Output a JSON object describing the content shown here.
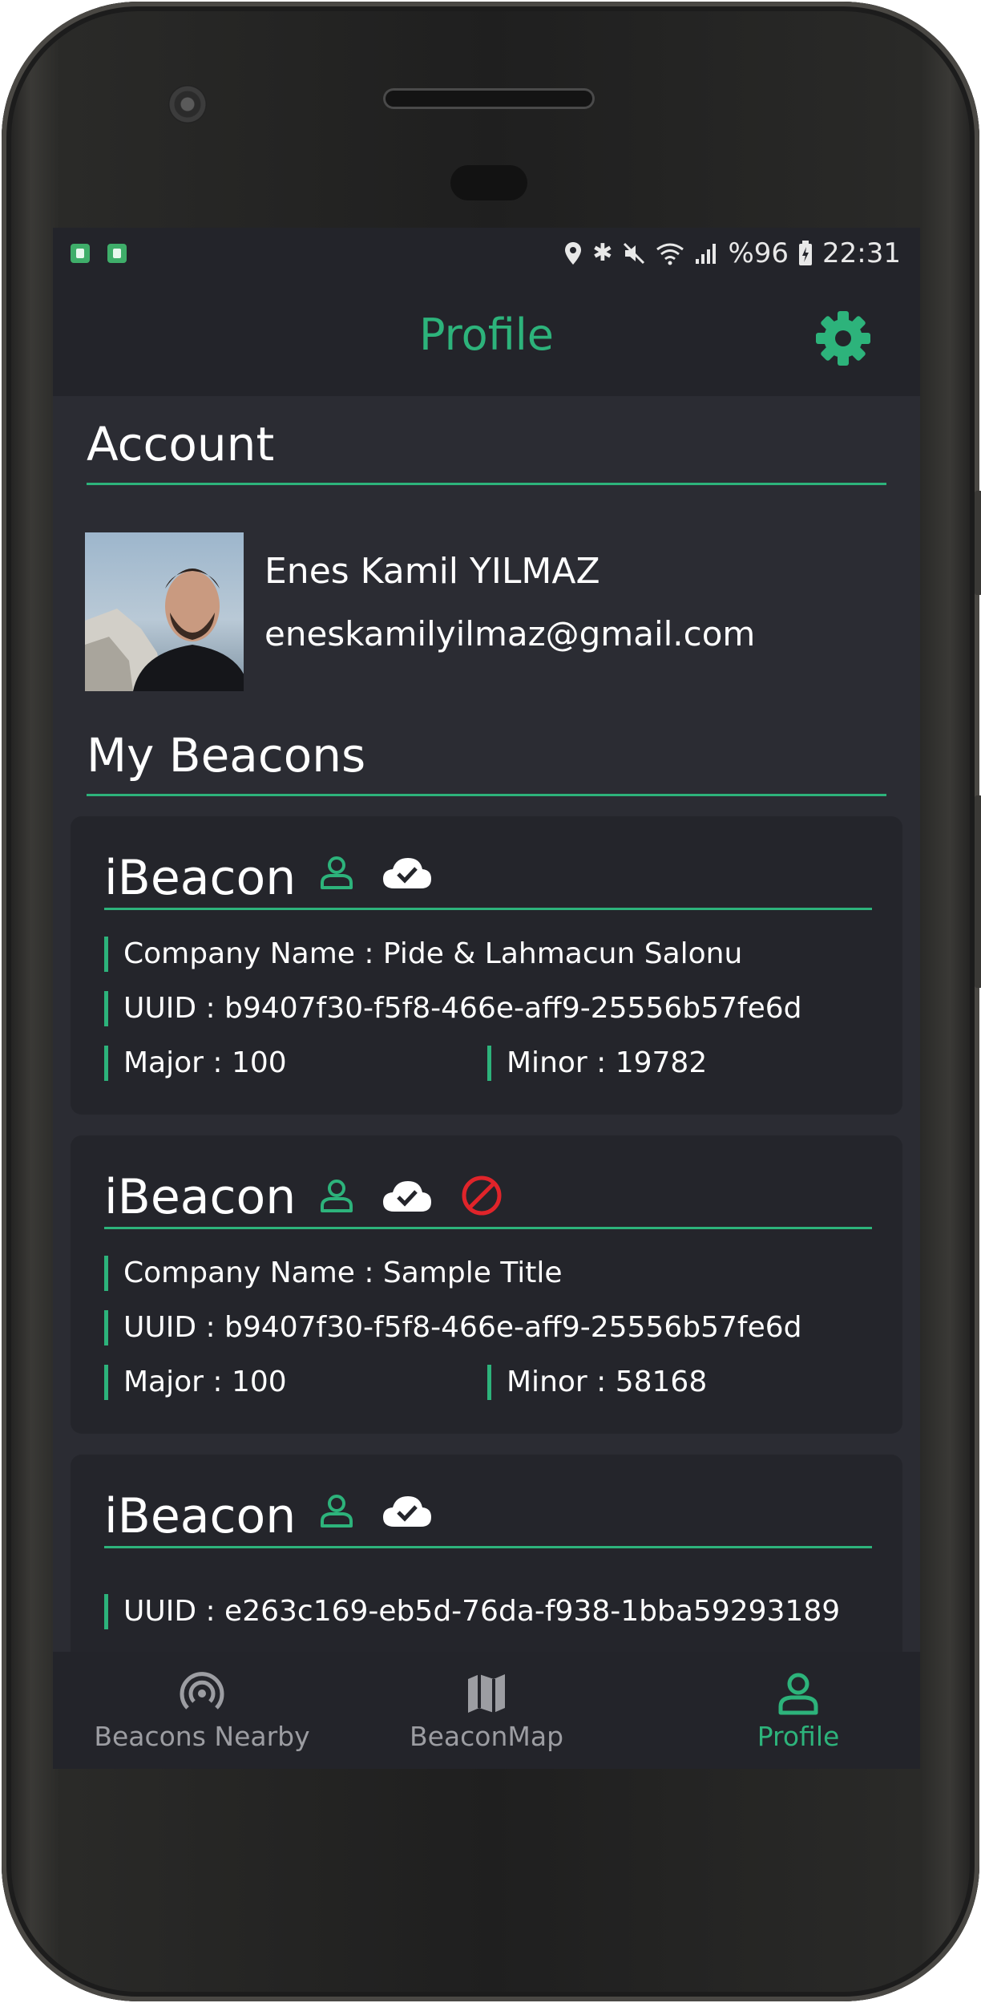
{
  "status_bar": {
    "battery": "%96",
    "time": "22:31"
  },
  "app_bar": {
    "title": "Profile"
  },
  "account": {
    "section_title": "Account",
    "name": "Enes Kamil YILMAZ",
    "email": "eneskamilyilmaz@gmail.com"
  },
  "beacons": {
    "section_title": "My Beacons",
    "items": [
      {
        "title": "iBeacon",
        "company": "Company Name : Pide & Lahmacun Salonu",
        "uuid": "UUID : b9407f30-f5f8-466e-aff9-25556b57fe6d",
        "major": "Major : 100",
        "minor": "Minor : 19782",
        "blocked": false
      },
      {
        "title": "iBeacon",
        "company": "Company Name : Sample Title",
        "uuid": "UUID : b9407f30-f5f8-466e-aff9-25556b57fe6d",
        "major": "Major : 100",
        "minor": "Minor : 58168",
        "blocked": true
      },
      {
        "title": "iBeacon",
        "company": "",
        "uuid": "UUID : e263c169-eb5d-76da-f938-1bba59293189",
        "major": "",
        "minor": "",
        "blocked": false
      }
    ]
  },
  "bottom_nav": {
    "items": [
      {
        "label": "Beacons Nearby",
        "icon": "radar-icon",
        "active": false
      },
      {
        "label": "BeaconMap",
        "icon": "map-icon",
        "active": false
      },
      {
        "label": "Profile",
        "icon": "person-icon",
        "active": true
      }
    ]
  },
  "colors": {
    "accent": "#2db37b",
    "background": "#2b2c33",
    "card": "#24252b",
    "bar": "#23242a",
    "blocked": "#e0242a"
  }
}
